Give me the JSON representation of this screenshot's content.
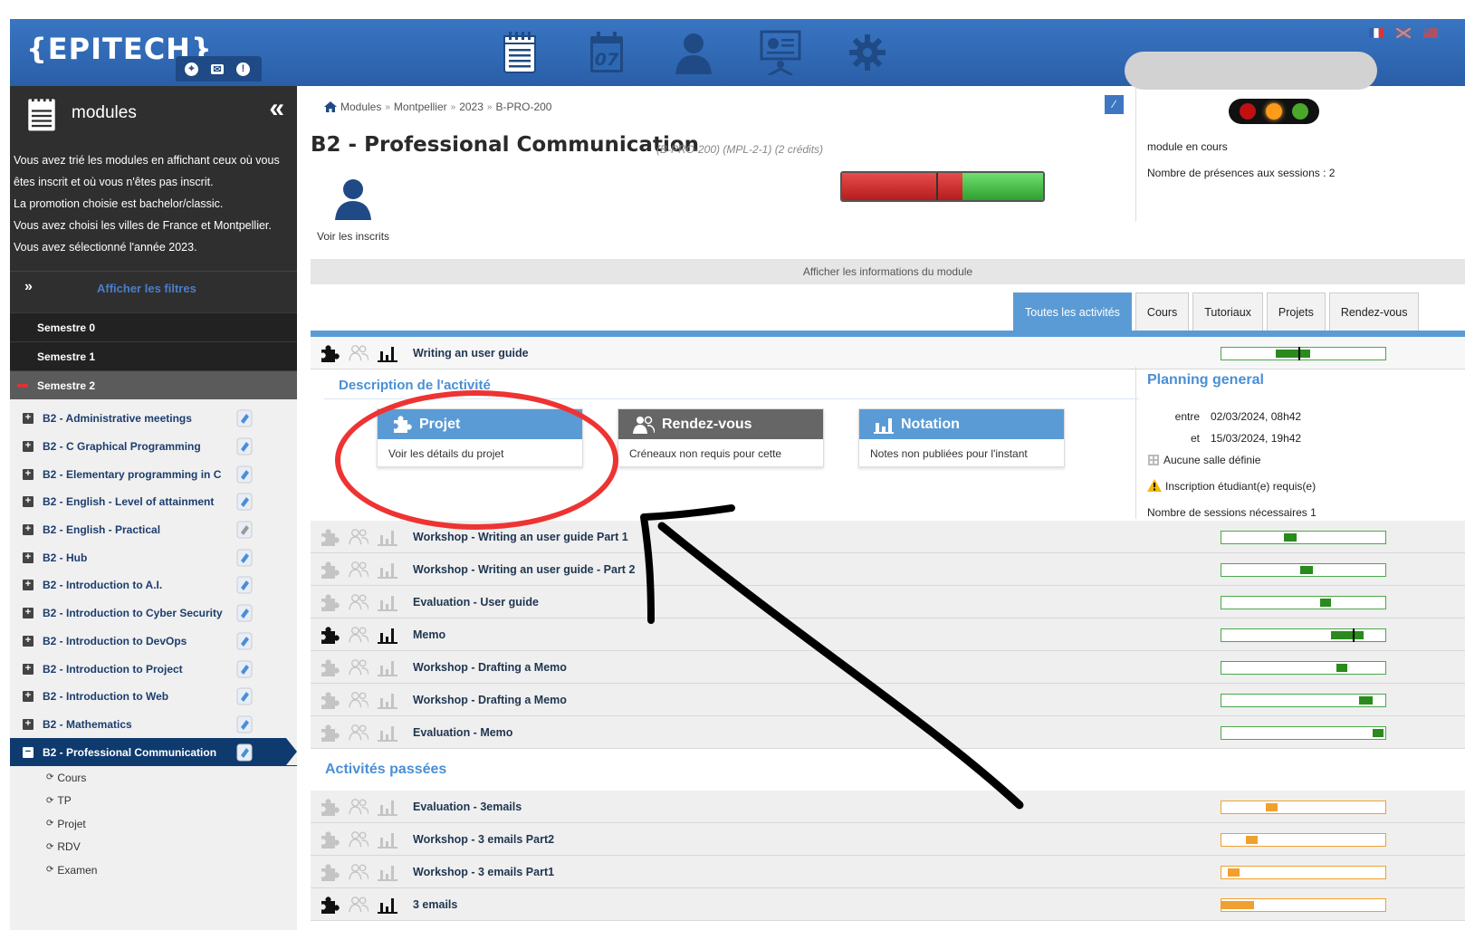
{
  "header": {
    "logo": "{EPITECH}",
    "tools": [
      "location-icon",
      "mail-icon",
      "alert-icon"
    ],
    "nav": [
      "notepad-icon",
      "calendar-icon",
      "user-icon",
      "presentation-icon",
      "gear-icon"
    ],
    "calendar_day": "07"
  },
  "sidebar": {
    "title": "modules",
    "collapse": "«",
    "info": [
      "Vous avez trié les modules en affichant ceux où vous êtes inscrit et où vous n'êtes pas inscrit.",
      "La promotion choisie est bachelor/classic.",
      "Vous avez choisi les villes de France et Montpellier.",
      "Vous avez sélectionné l'année 2023."
    ],
    "filter_chev": "»",
    "filter_label": "Afficher les filtres",
    "semesters": [
      "Semestre 0",
      "Semestre 1",
      "Semestre 2"
    ],
    "modules": [
      "B2 - Administrative meetings",
      "B2 - C Graphical Programming",
      "B2 - Elementary programming in C",
      "B2 - English - Level of attainment",
      "B2 - English - Practical",
      "B2 - Hub",
      "B2 - Introduction to A.I.",
      "B2 - Introduction to Cyber Security",
      "B2 - Introduction to DevOps",
      "B2 - Introduction to Project",
      "B2 - Introduction to Web",
      "B2 - Mathematics",
      "B2 - Professional Communication"
    ],
    "sub_items": [
      "Cours",
      "TP",
      "Projet",
      "RDV",
      "Examen"
    ]
  },
  "breadcrumb": [
    "Modules",
    "Montpellier",
    "2023",
    "B-PRO-200"
  ],
  "module": {
    "title": "B2 - Professional Communication",
    "subtitle": "(B-PRO-200) (MPL-2-1) (2 crédits)",
    "voir": "Voir les inscrits",
    "status": "module en cours",
    "presences": "Nombre de présences aux sessions : 2",
    "info_bar": "Afficher les informations du module",
    "progress": {
      "red_fraction": 0.6,
      "green_fraction": 0.4
    }
  },
  "tabs": [
    "Toutes les activités",
    "Cours",
    "Tutoriaux",
    "Projets",
    "Rendez-vous"
  ],
  "activities": [
    {
      "label": "Writing an user guide",
      "active": true,
      "fill_start": 0.33,
      "fill_end": 0.54,
      "tick": 0.47
    },
    {
      "label": "Workshop - Writing an user guide Part 1",
      "active": false,
      "fill_start": 0.38,
      "fill_end": 0.46
    },
    {
      "label": "Workshop - Writing an user guide - Part 2",
      "active": false,
      "fill_start": 0.48,
      "fill_end": 0.56
    },
    {
      "label": "Evaluation - User guide",
      "active": false,
      "fill_start": 0.6,
      "fill_end": 0.67
    },
    {
      "label": "Memo",
      "active": true,
      "fill_start": 0.67,
      "fill_end": 0.87,
      "tick": 0.8
    },
    {
      "label": "Workshop - Drafting a Memo",
      "active": false,
      "fill_start": 0.7,
      "fill_end": 0.77
    },
    {
      "label": "Workshop - Drafting a Memo",
      "active": false,
      "fill_start": 0.84,
      "fill_end": 0.92
    },
    {
      "label": "Evaluation - Memo",
      "active": false,
      "fill_start": 0.92,
      "fill_end": 0.99
    }
  ],
  "description": {
    "title": "Description de l'activité",
    "cards": [
      {
        "title": "Projet",
        "body": "Voir les détails du projet"
      },
      {
        "title": "Rendez-vous",
        "body": "Créneaux non requis pour cette"
      },
      {
        "title": "Notation",
        "body": "Notes non publiées pour l'instant"
      }
    ]
  },
  "planning": {
    "title": "Planning general",
    "entre_label": "entre",
    "entre": "02/03/2024, 08h42",
    "et_label": "et",
    "et": "15/03/2024, 19h42",
    "salle": "Aucune salle définie",
    "inscription": "Inscription étudiant(e) requis(e)",
    "sessions": "Nombre de sessions nécessaires 1"
  },
  "past": {
    "title": "Activités passées",
    "items": [
      {
        "label": "Evaluation - 3emails",
        "fill_start": 0.27,
        "fill_end": 0.34
      },
      {
        "label": "Workshop - 3 emails Part2",
        "fill_start": 0.15,
        "fill_end": 0.22
      },
      {
        "label": "Workshop - 3 emails Part1",
        "fill_start": 0.04,
        "fill_end": 0.11
      },
      {
        "label": "3 emails",
        "fill_start": 0.0,
        "fill_end": 0.2
      }
    ]
  },
  "colors": {
    "brand": "#2d68b3",
    "accent": "#5b9bd5",
    "annotation": "#ee3333"
  }
}
